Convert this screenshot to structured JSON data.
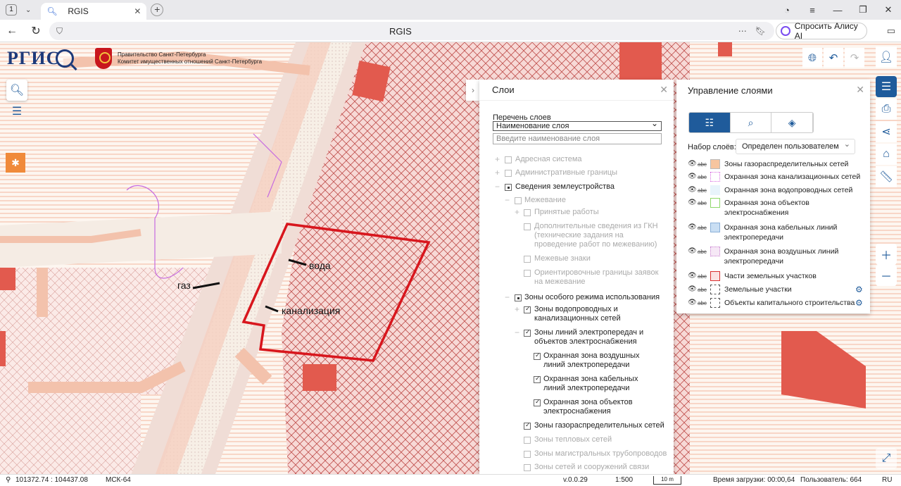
{
  "browser": {
    "tab_count": "1",
    "tab_title": "RGIS",
    "url": "RGIS",
    "alice_label": "Спросить Алису AI"
  },
  "header": {
    "logo": "РГИС",
    "gov_line1": "Правительство Санкт-Петербурга",
    "gov_line2": "Комитет имущественных отношений Санкт-Петербурга"
  },
  "map_labels": {
    "voda": "вода",
    "gaz": "газ",
    "kanal": "канализация"
  },
  "layers_panel": {
    "title": "Слои",
    "list_label": "Перечень слоев",
    "select_value": "Наименование слоя",
    "search_placeholder": "Введите наименование слоя",
    "items": [
      "Адресная система",
      "Административные границы",
      "Сведения землеустройства",
      "Межевание",
      "Принятые работы",
      "Дополнительные сведения из ГКН (технические задания на проведение работ по межеванию)",
      "Межевые знаки",
      "Ориентировочные границы заявок на межевание",
      "Зоны особого режима использования",
      "Зоны водопроводных и канализационных сетей",
      "Зоны линий электропередач и объектов электроснабжения",
      "Охранная зона воздушных линий электропередачи",
      "Охранная зона кабельных линий электропередачи",
      "Охранная зона объектов электроснабжения",
      "Зоны газораспределительных сетей",
      "Зоны тепловых сетей",
      "Зоны магистральных трубопроводов",
      "Зоны сетей и сооружений связи"
    ]
  },
  "mgmt_panel": {
    "title": "Управление слоями",
    "set_label": "Набор слоёв:",
    "set_value": "Определен пользователем",
    "rows": [
      "Зоны газораспределительных сетей",
      "Охранная зона канализационных сетей",
      "Охранная зона водопроводных сетей",
      "Охранная зона объектов электроснабжения",
      "Охранная зона кабельных линий электропередачи",
      "Охранная зона воздушных линий электропередачи",
      "Части земельных участков",
      "Земельные участки",
      "Объекты капитального строительства"
    ],
    "colors": {
      "gas": "#f7c59f",
      "sewer": "#d86be0",
      "water": "#e8f4fb",
      "power_obj": "#8fd86b",
      "cable": "#c9def3",
      "air": "#e6b8e6",
      "parts": "#d93030"
    }
  },
  "status": {
    "coords": "101372.74 : 104437.08",
    "crs": "МСК-64",
    "version": "v.0.0.29",
    "scale": "1:500",
    "scalebar": "10 m",
    "load_time": "Время загрузки: 00:00,64",
    "user": "Пользователь: 664",
    "lang": "RU"
  }
}
